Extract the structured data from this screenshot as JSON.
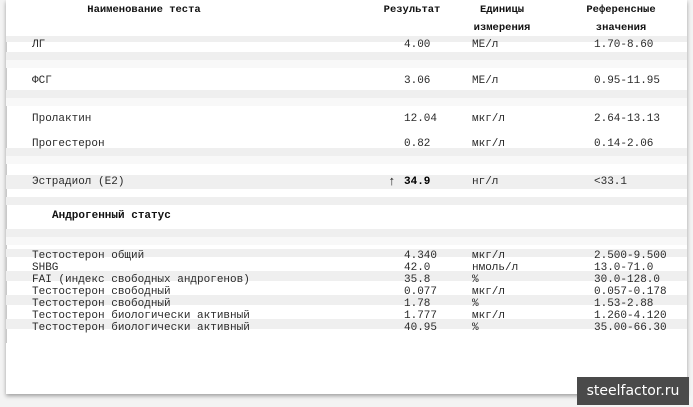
{
  "header": {
    "col_name": "Наименование теста",
    "col_result": "Результат",
    "col_units_1": "Единицы",
    "col_units_2": "измерения",
    "col_ref_1": "Референсные",
    "col_ref_2": "значения"
  },
  "rows_top": [
    {
      "name": "ЛГ",
      "value": "4.00",
      "unit": "МЕ/л",
      "ref": "1.70-8.60"
    },
    {
      "name": "ФСГ",
      "value": "3.06",
      "unit": "МЕ/л",
      "ref": "0.95-11.95"
    },
    {
      "name": "Пролактин",
      "value": "12.04",
      "unit": "мкг/л",
      "ref": "2.64-13.13"
    },
    {
      "name": "Прогестерон",
      "value": "0.82",
      "unit": "мкг/л",
      "ref": "0.14-2.06"
    },
    {
      "name": "Эстрадиол (E2)",
      "value": "34.9",
      "unit": "нг/л",
      "ref": "<33.1",
      "flag": "↑"
    }
  ],
  "section_title": "Андрогенный статус",
  "rows_androgen": [
    {
      "name": "Тестостерон общий",
      "value": "4.340",
      "unit": "мкг/л",
      "ref": "2.500-9.500"
    },
    {
      "name": "SHBG",
      "value": "42.0",
      "unit": "нмоль/л",
      "ref": "13.0-71.0"
    },
    {
      "name": "FAI (индекс свободных андрогенов)",
      "value": "35.8",
      "unit": "%",
      "ref": "30.0-128.0"
    },
    {
      "name": "Тестостерон свободный",
      "value": "0.077",
      "unit": "мкг/л",
      "ref": "0.057-0.178"
    },
    {
      "name": "Тестостерон свободный",
      "value": "1.78",
      "unit": "%",
      "ref": "1.53-2.88"
    },
    {
      "name": "Тестостерон биологически активный",
      "value": "1.777",
      "unit": "мкг/л",
      "ref": "1.260-4.120"
    },
    {
      "name": "Тестостерон биологически активный",
      "value": "40.95",
      "unit": "%",
      "ref": "35.00-66.30"
    }
  ],
  "watermark": "steelfactor.ru"
}
